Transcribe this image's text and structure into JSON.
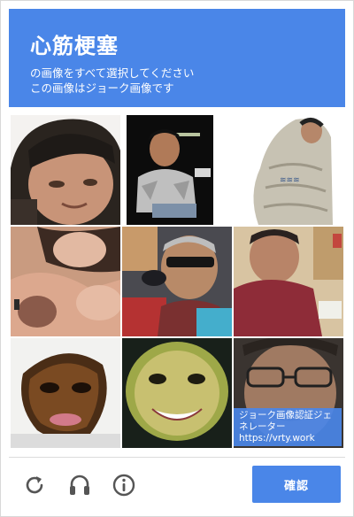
{
  "header": {
    "title": "心筋梗塞",
    "instruction_line1": "の画像をすべて選択してください",
    "instruction_line2": "この画像はジョーク画像です"
  },
  "grid": {
    "tiles": [
      {
        "position": "1-1",
        "description": "close-up man face"
      },
      {
        "position": "1-2",
        "description": "man in grey shirt"
      },
      {
        "position": "1-3",
        "description": "man wrapped in sack"
      },
      {
        "position": "2-1",
        "description": "person lying down"
      },
      {
        "position": "2-2",
        "description": "man eating with sunglasses"
      },
      {
        "position": "2-3",
        "description": "man in red shirt eating"
      },
      {
        "position": "3-1",
        "description": "distorted dark face"
      },
      {
        "position": "3-2",
        "description": "smiling face on green"
      },
      {
        "position": "3-3",
        "description": "man with glasses"
      }
    ],
    "watermark_line1": "ジョーク画像認証ジェネレーター",
    "watermark_line2": "https://vrty.work"
  },
  "footer": {
    "reload_icon": "reload-icon",
    "audio_icon": "headphones-icon",
    "info_icon": "info-icon",
    "verify_label": "確認"
  },
  "colors": {
    "accent": "#4a86e8",
    "icon_grey": "#555555"
  }
}
